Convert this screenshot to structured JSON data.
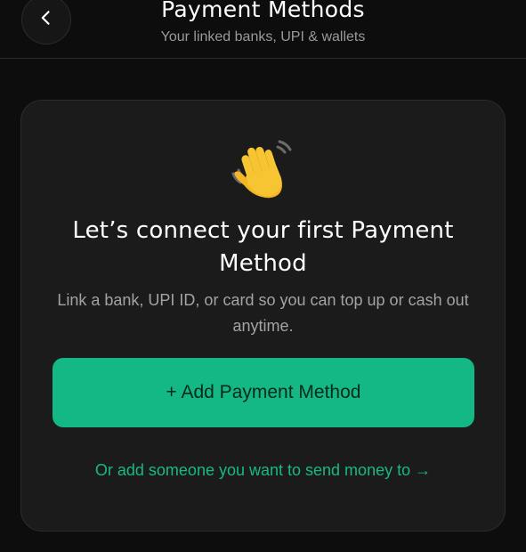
{
  "header": {
    "title": "Payment Methods",
    "subtitle": "Your linked banks, UPI & wallets",
    "back_icon": "chevron-left-icon"
  },
  "empty_state": {
    "icon": "waving-hand-icon",
    "heading": "Let’s connect your first Payment Method",
    "description": "Link a bank, UPI ID, or card so you can top up or cash out anytime.",
    "primary_button_label": "+ Add Payment Method",
    "secondary_link_label": "Or add someone you want to send money to →"
  },
  "colors": {
    "background": "#0d0d0d",
    "card": "#1b1b1b",
    "accent": "#14b885",
    "link": "#17b987",
    "muted_text": "#a3a3a3"
  }
}
